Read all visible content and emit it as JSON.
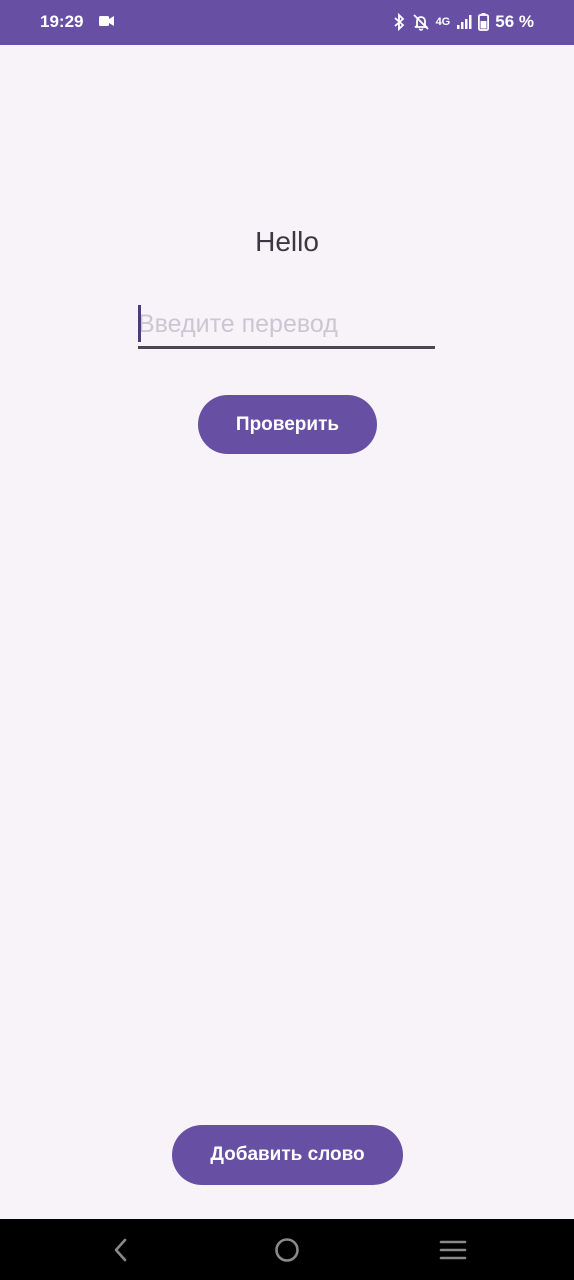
{
  "status_bar": {
    "time": "19:29",
    "network": "4G",
    "battery": "56 %",
    "icons": [
      "video-icon",
      "bluetooth-icon",
      "mute-icon",
      "signal-icon",
      "battery-icon"
    ],
    "background_color": "#6750a4"
  },
  "main": {
    "word": "Hello",
    "translation_input": {
      "value": "",
      "placeholder": "Введите перевод"
    },
    "check_button_label": "Проверить"
  },
  "footer": {
    "add_word_button_label": "Добавить слово"
  },
  "nav_bar": {
    "icons": [
      "back-icon",
      "home-icon",
      "recent-apps-icon"
    ]
  },
  "colors": {
    "accent": "#6750a4",
    "background": "#f7f3f8",
    "text": "#3c3841"
  }
}
